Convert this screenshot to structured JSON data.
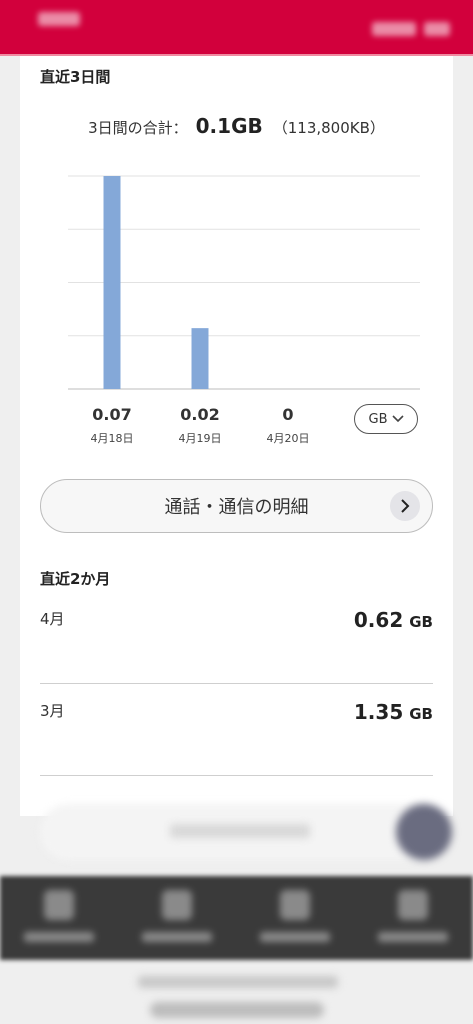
{
  "header": {
    "accent_color": "#d2003c"
  },
  "recent3days": {
    "title": "直近3日間",
    "total_label": "3日間の合計：",
    "total_value": "0.1GB",
    "total_kb": "（113,800KB）",
    "unit_select": "GB",
    "days": [
      {
        "value_label": "0.07",
        "date": "4月18日"
      },
      {
        "value_label": "0.02",
        "date": "4月19日"
      },
      {
        "value_label": "0",
        "date": "4月20日"
      }
    ]
  },
  "chart_data": {
    "type": "bar",
    "categories": [
      "4月18日",
      "4月19日",
      "4月20日"
    ],
    "values": [
      0.07,
      0.02,
      0
    ],
    "title": "",
    "xlabel": "",
    "ylabel": "",
    "ylim": [
      0,
      0.07
    ],
    "grid": true,
    "bar_color": "#84a8d8"
  },
  "detail_button": {
    "label": "通話・通信の明細",
    "icon": "chevron-right-icon"
  },
  "recent2months": {
    "title": "直近2か月",
    "months": [
      {
        "month": "4月",
        "value": "0.62",
        "unit": "GB"
      },
      {
        "month": "3月",
        "value": "1.35",
        "unit": "GB"
      }
    ]
  }
}
